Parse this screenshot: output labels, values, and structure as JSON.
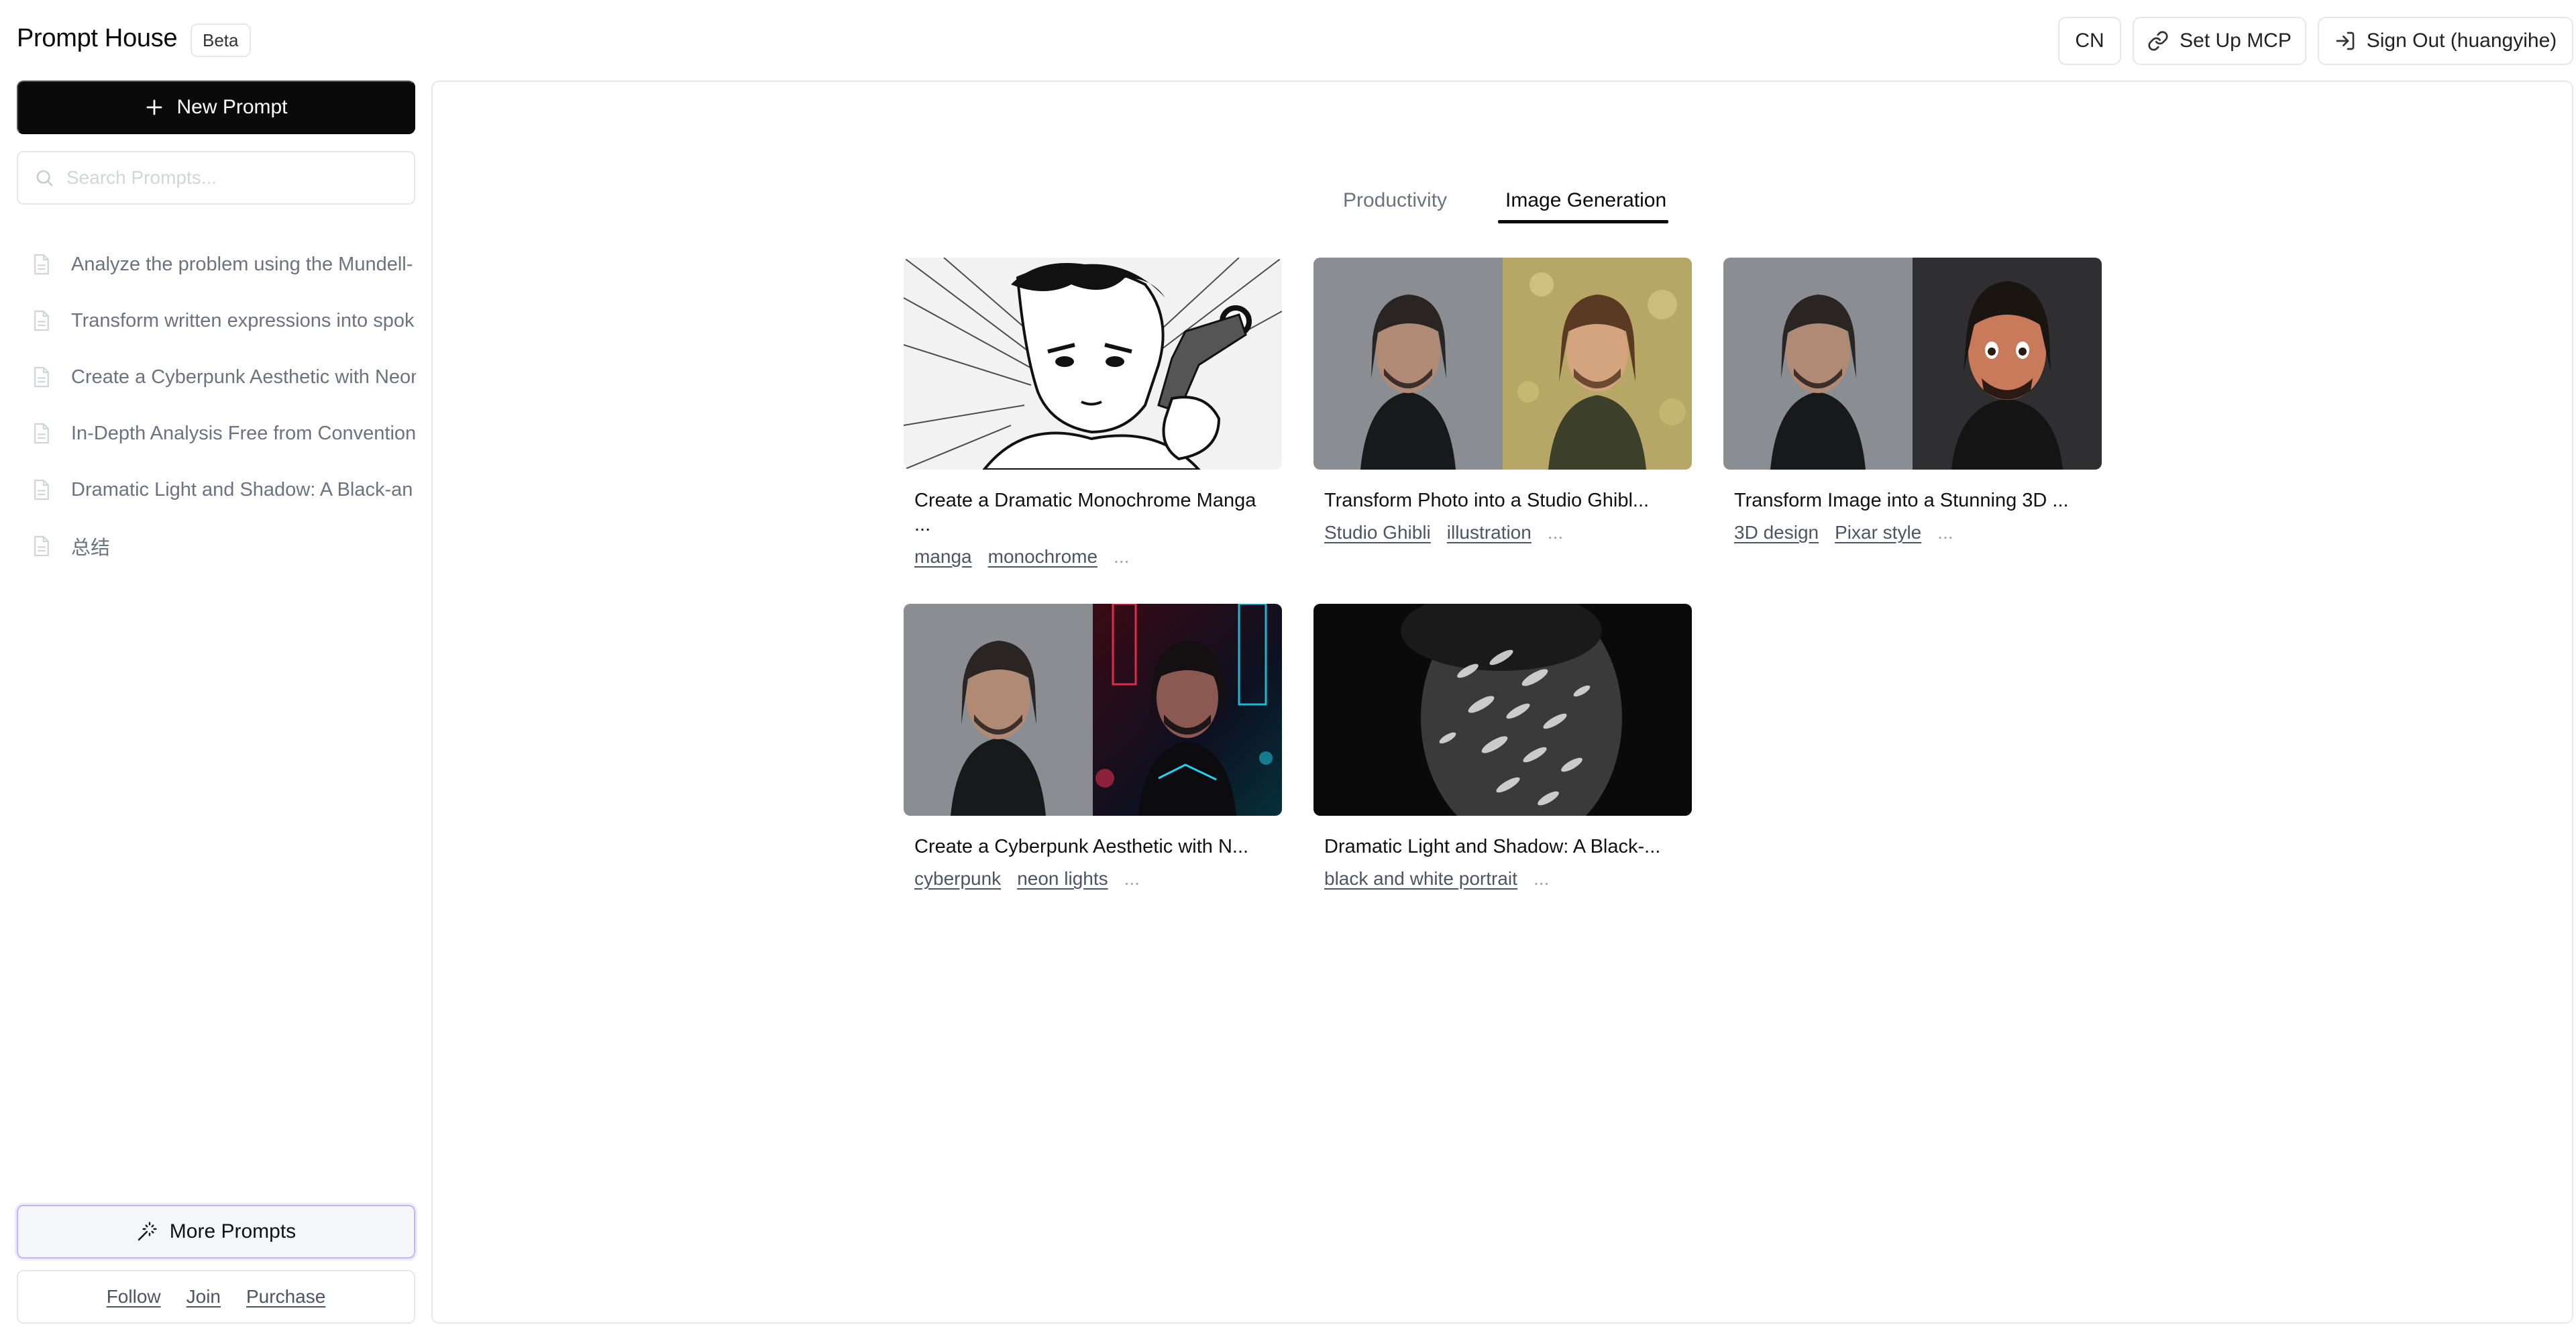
{
  "header": {
    "app_title": "Prompt House",
    "beta_label": "Beta",
    "lang_button": "CN",
    "mcp_button": "Set Up MCP",
    "sign_out_button": "Sign Out (huangyihe)"
  },
  "sidebar": {
    "new_prompt_label": "New Prompt",
    "search_placeholder": "Search Prompts...",
    "items": [
      {
        "label": "Analyze the problem using the Mundell-"
      },
      {
        "label": "Transform written expressions into spok"
      },
      {
        "label": "Create a Cyberpunk Aesthetic with Neon"
      },
      {
        "label": "In-Depth Analysis Free from Convention"
      },
      {
        "label": "Dramatic Light and Shadow: A Black-an"
      },
      {
        "label": "总结"
      }
    ],
    "more_prompts_label": "More Prompts",
    "footer_links": {
      "follow": "Follow",
      "join": "Join",
      "purchase": "Purchase"
    }
  },
  "main": {
    "tabs": [
      {
        "label": "Productivity",
        "active": false
      },
      {
        "label": "Image Generation",
        "active": true
      }
    ],
    "cards": [
      {
        "title": "Create a Dramatic Monochrome Manga ...",
        "tags": [
          "manga",
          "monochrome"
        ],
        "more": "..."
      },
      {
        "title": "Transform Photo into a Studio Ghibl...",
        "tags": [
          "Studio Ghibli",
          "illustration"
        ],
        "more": "..."
      },
      {
        "title": "Transform Image into a Stunning 3D ...",
        "tags": [
          "3D design",
          "Pixar style"
        ],
        "more": "..."
      },
      {
        "title": "Create a Cyberpunk Aesthetic with N...",
        "tags": [
          "cyberpunk",
          "neon lights"
        ],
        "more": "..."
      },
      {
        "title": "Dramatic Light and Shadow: A Black-...",
        "tags": [
          "black and white portrait"
        ],
        "more": "..."
      }
    ]
  },
  "colors": {
    "primary": "#0a0a0a",
    "border": "#e5e7eb",
    "muted_text": "#6b7280",
    "accent_outline": "#c4b5fd"
  }
}
